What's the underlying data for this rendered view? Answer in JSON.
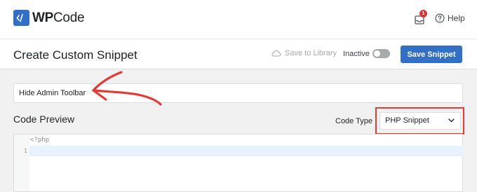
{
  "brand": {
    "name_bold": "WP",
    "name_rest": "Code",
    "accent": "#3170c6"
  },
  "topbar": {
    "notification_count": "1",
    "help_label": "Help",
    "inbox_icon": "inbox-icon",
    "help_icon": "question-circle-icon"
  },
  "header": {
    "title": "Create Custom Snippet",
    "save_to_library_label": "Save to Library",
    "status_label": "Inactive",
    "active": false,
    "save_button_label": "Save Snippet"
  },
  "snippet": {
    "title_value": "Hide Admin Toolbar"
  },
  "code_preview": {
    "label": "Code Preview",
    "code_type_label": "Code Type",
    "code_type_value": "PHP Snippet",
    "prefix_line": "<?php",
    "lines": [
      "1"
    ]
  },
  "annotation_color": "#e53935"
}
